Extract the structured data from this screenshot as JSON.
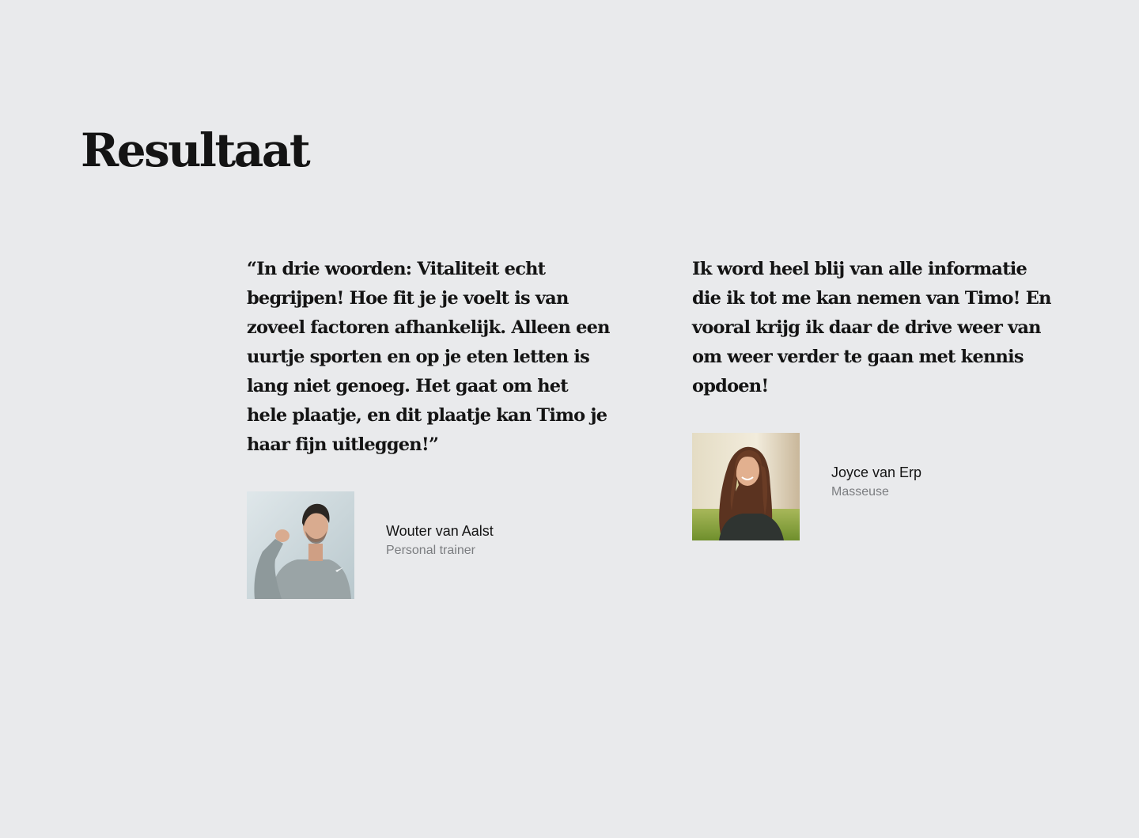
{
  "section": {
    "title": "Resultaat"
  },
  "testimonials": [
    {
      "quote": "“In drie woorden: Vitaliteit echt begrijpen! Hoe fit je je voelt is van zoveel factoren afhankelijk. Alleen een uurtje sporten en op je eten letten is lang niet genoeg. Het gaat om het hele plaatje, en dit plaatje kan Timo je haar fijn uitleggen!”",
      "name": "Wouter van Aalst",
      "role": "Personal trainer"
    },
    {
      "quote": "Ik word heel blij van alle informatie die ik tot me kan nemen van Timo! En vooral krijg ik daar de drive weer van om weer verder te gaan met kennis opdoen!",
      "name": "Joyce van Erp",
      "role": "Masseuse"
    }
  ],
  "colors": {
    "background": "#e9eaec",
    "text": "#141414",
    "muted": "#7b7d80"
  }
}
